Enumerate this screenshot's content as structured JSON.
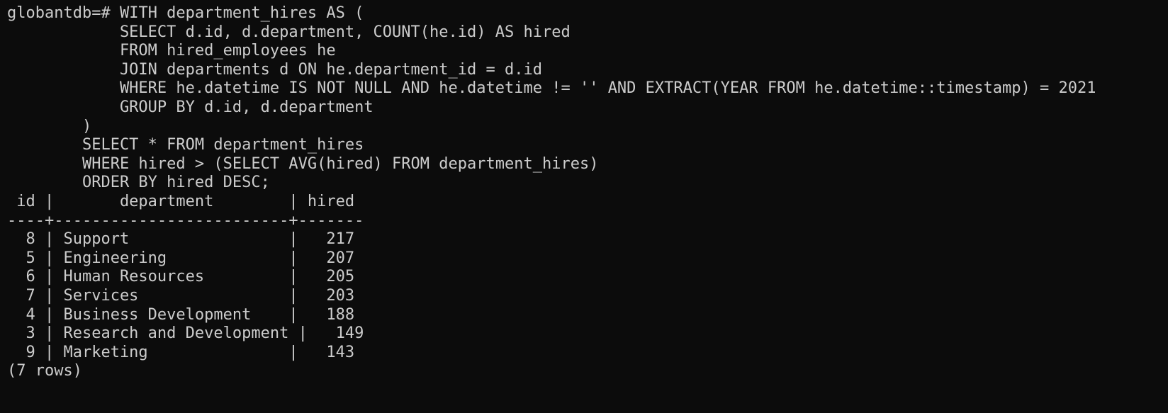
{
  "terminal": {
    "prompt": "globantdb=# ",
    "query_lines": [
      "WITH department_hires AS (",
      "            SELECT d.id, d.department, COUNT(he.id) AS hired",
      "            FROM hired_employees he",
      "            JOIN departments d ON he.department_id = d.id",
      "            WHERE he.datetime IS NOT NULL AND he.datetime != '' AND EXTRACT(YEAR FROM he.datetime::timestamp) = 2021",
      "            GROUP BY d.id, d.department",
      "        )",
      "        SELECT * FROM department_hires",
      "        WHERE hired > (SELECT AVG(hired) FROM department_hires)",
      "        ORDER BY hired DESC;"
    ],
    "result": {
      "header_line": " id |       department        | hired",
      "separator_line": "----+-------------------------+-------",
      "rows": [
        "  8 | Support                 |   217",
        "  5 | Engineering             |   207",
        "  6 | Human Resources         |   205",
        "  7 | Services                |   203",
        "  4 | Business Development    |   188",
        "  3 | Research and Development |   149",
        "  9 | Marketing               |   143"
      ],
      "footer": "(7 rows)"
    }
  }
}
